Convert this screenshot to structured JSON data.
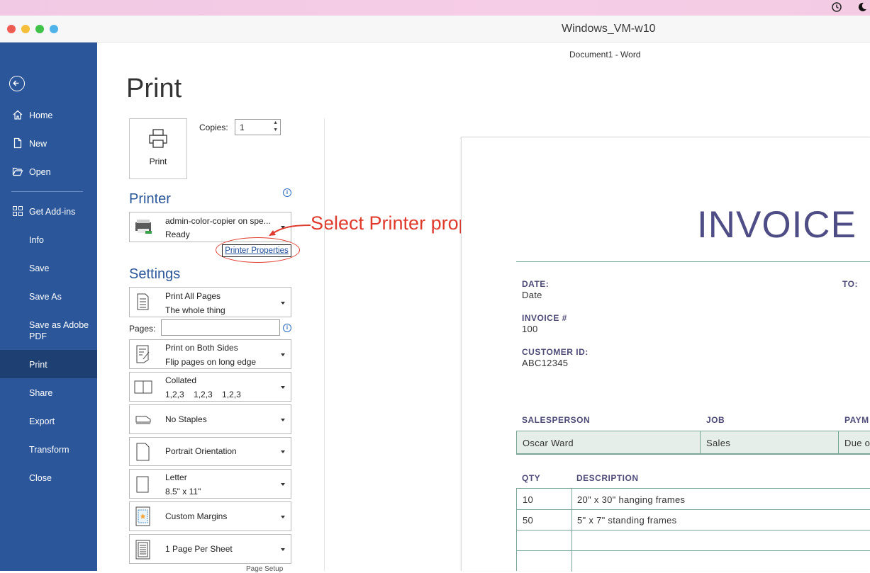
{
  "window": {
    "title": "Windows_VM-w10",
    "doc_caption": "Document1  -  Word"
  },
  "sidebar": {
    "items": [
      {
        "label": "Home"
      },
      {
        "label": "New"
      },
      {
        "label": "Open"
      },
      {
        "label": "Get Add-ins"
      },
      {
        "label": "Info"
      },
      {
        "label": "Save"
      },
      {
        "label": "Save As"
      },
      {
        "label": "Save as Adobe PDF"
      },
      {
        "label": "Print"
      },
      {
        "label": "Share"
      },
      {
        "label": "Export"
      },
      {
        "label": "Transform"
      },
      {
        "label": "Close"
      }
    ]
  },
  "print": {
    "heading": "Print",
    "button_label": "Print",
    "copies_label": "Copies:",
    "copies_value": "1",
    "printer_heading": "Printer",
    "printer_name": "admin-color-copier on spe...",
    "printer_status": "Ready",
    "printer_properties": "Printer Properties",
    "settings_heading": "Settings",
    "pages_label": "Pages:",
    "pages_value": "",
    "settings": [
      {
        "line1": "Print All Pages",
        "line2": "The whole thing"
      },
      {
        "line1": "Print on Both Sides",
        "line2": "Flip pages on long edge"
      },
      {
        "line1": "Collated",
        "line2": "1,2,3    1,2,3    1,2,3"
      },
      {
        "line1": "No Staples",
        "line2": ""
      },
      {
        "line1": "Portrait Orientation",
        "line2": ""
      },
      {
        "line1": "Letter",
        "line2": "8.5\" x 11\""
      },
      {
        "line1": "Custom Margins",
        "line2": ""
      },
      {
        "line1": "1 Page Per Sheet",
        "line2": ""
      }
    ],
    "cutoff_text": "Page Setup"
  },
  "annotation": {
    "text": "Select Printer properties",
    "color": "#e03a2c"
  },
  "invoice": {
    "title": "INVOICE",
    "date_label": "DATE:",
    "date_value": "Date",
    "to_label": "TO:",
    "invoice_label": "INVOICE #",
    "invoice_value": "100",
    "customer_label": "CUSTOMER ID:",
    "customer_value": "ABC12345",
    "headers": [
      "SALESPERSON",
      "JOB",
      "PAYM"
    ],
    "sales_row": [
      "Oscar Ward",
      "Sales",
      "Due o"
    ],
    "items_headers": [
      "QTY",
      "DESCRIPTION"
    ],
    "items": [
      {
        "qty": "10",
        "desc": "20\" x 30\" hanging frames"
      },
      {
        "qty": "50",
        "desc": "5\" x 7\" standing frames"
      }
    ]
  },
  "colors": {
    "sidebar": "#2b579a",
    "sidebar_active": "#1e3f72",
    "accent_text": "#4f4d85",
    "table_fill": "#e6eee9"
  }
}
